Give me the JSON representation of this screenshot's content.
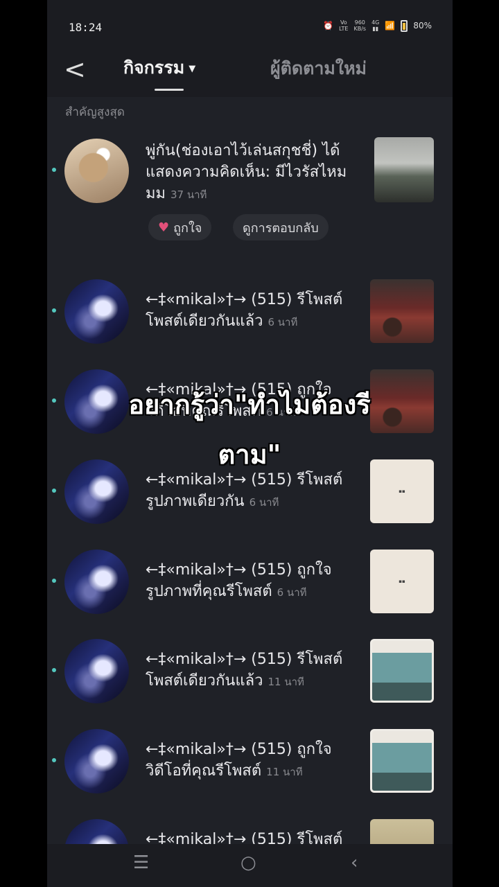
{
  "status": {
    "time": "18:24",
    "battery": "80%"
  },
  "header": {
    "back": "<",
    "tab_activity": "กิจกรรม",
    "tab_followers": "ผู้ติดตามใหม่"
  },
  "section_title": "สำคัญสูงสุด",
  "items": [
    {
      "text": "พู่กัน(ช่องเอาไว้เล่นสกุชชี่) ได้แสดงความคิดเห็น: มีไวรัสไหมมม",
      "ago": "37 นาที",
      "like": "ถูกใจ",
      "reply": "ดูการตอบกลับ"
    },
    {
      "text": "←‡«mikal»†→ (515) รีโพสต์โพสต์เดียวกันแล้ว",
      "ago": "6 นาที"
    },
    {
      "text": "←‡«mikal»†→ (515) ถูกใจวิดีโอที่คุณรีโพสต์",
      "ago": "6 นาที"
    },
    {
      "text": "←‡«mikal»†→ (515) รีโพสต์รูปภาพเดียวกัน",
      "ago": "6 นาที"
    },
    {
      "text": "←‡«mikal»†→ (515) ถูกใจรูปภาพที่คุณรีโพสต์",
      "ago": "6 นาที"
    },
    {
      "text": "←‡«mikal»†→ (515) รีโพสต์โพสต์เดียวกันแล้ว",
      "ago": "11 นาที"
    },
    {
      "text": "←‡«mikal»†→ (515) ถูกใจวิดีโอที่คุณรีโพสต์",
      "ago": "11 นาที"
    },
    {
      "text": "←‡«mikal»†→ (515) รีโพสต์",
      "ago": ""
    }
  ],
  "overlay_caption": "อยากรู้ว่า\"ทำไมต้องรีตาม\"",
  "colors": {
    "accent_dot": "#53c7be",
    "heart": "#e2507a"
  },
  "icons": [
    "back-chevron-icon",
    "dropdown-caret-icon",
    "heart-icon",
    "menu-icon",
    "home-circle-icon",
    "back-nav-icon"
  ]
}
